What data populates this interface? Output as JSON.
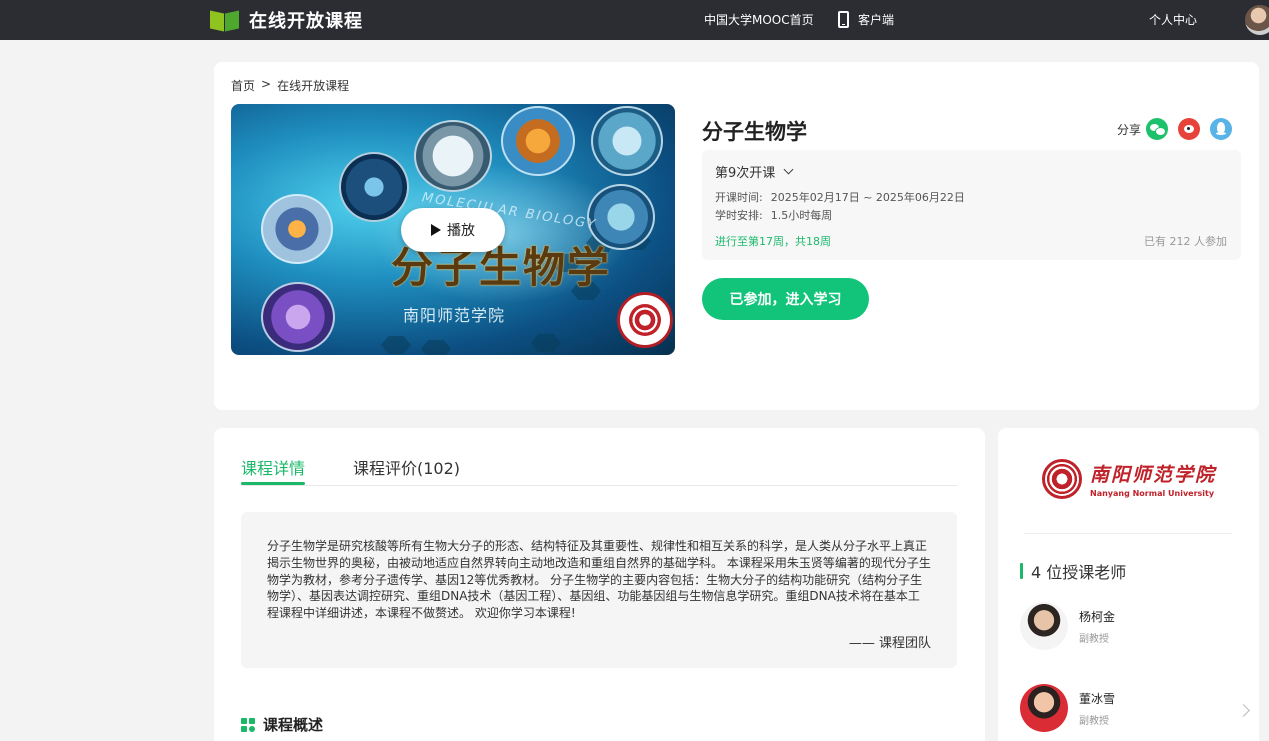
{
  "topnav": {
    "logo_text": "在线开放课程",
    "home_link": "中国大学MOOC首页",
    "client_link": "客户端",
    "user_link": "个人中心"
  },
  "breadcrumb": {
    "items": [
      "首页",
      ">",
      "在线开放课程"
    ]
  },
  "cover": {
    "play_label": "播放",
    "title_text": "分子生物学",
    "subtitle_text": "南阳师范学院",
    "arc_text": "MOLECULAR BIOLOGY"
  },
  "course": {
    "title": "分子生物学",
    "share_label": "分享",
    "term_label": "第9次开课",
    "time_label": "开课时间:",
    "time_value": "2025年02月17日 ~ 2025年06月22日",
    "schedule_label": "学时安排:",
    "schedule_value": "1.5小时每周",
    "progress": "进行至第17周，共18周",
    "participants": "已有 212 人参加",
    "join_button": "已参加，进入学习"
  },
  "tabs": [
    {
      "label": "课程详情"
    },
    {
      "label": "课程评价(102)"
    }
  ],
  "intro": {
    "text": "分子生物学是研究核酸等所有生物大分子的形态、结构特征及其重要性、规律性和相互关系的科学，是人类从分子水平上真正揭示生物世界的奥秘，由被动地适应自然界转向主动地改造和重组自然界的基础学科。 本课程采用朱玉贤等编著的现代分子生物学为教材，参考分子遗传学、基因12等优秀教材。 分子生物学的主要内容包括：生物大分子的结构功能研究（结构分子生物学）、基因表达调控研究、重组DNA技术（基因工程）、基因组、功能基因组与生物信息学研究。重组DNA技术将在基本工程课程中详细讲述，本课程不做赘述。 欢迎你学习本课程!",
    "signature": "—— 课程团队"
  },
  "section": {
    "overview_title": "课程概述"
  },
  "school": {
    "name_cn": "南阳师范学院",
    "name_en": "Nanyang Normal University"
  },
  "teachers": {
    "heading": "4 位授课老师",
    "list": [
      {
        "name": "杨柯金",
        "title": "副教授"
      },
      {
        "name": "董冰雪",
        "title": "副教授"
      }
    ]
  },
  "colors": {
    "accent": "#1cb86a",
    "topbar": "#2b2d33",
    "join_button": "#11c47a",
    "school_red": "#c0222a"
  },
  "icons": [
    "logo-book-icon",
    "phone-icon",
    "play-icon",
    "chevron-down-icon",
    "wechat-icon",
    "weibo-icon",
    "qq-icon",
    "grid-icon",
    "chevron-right-icon"
  ]
}
